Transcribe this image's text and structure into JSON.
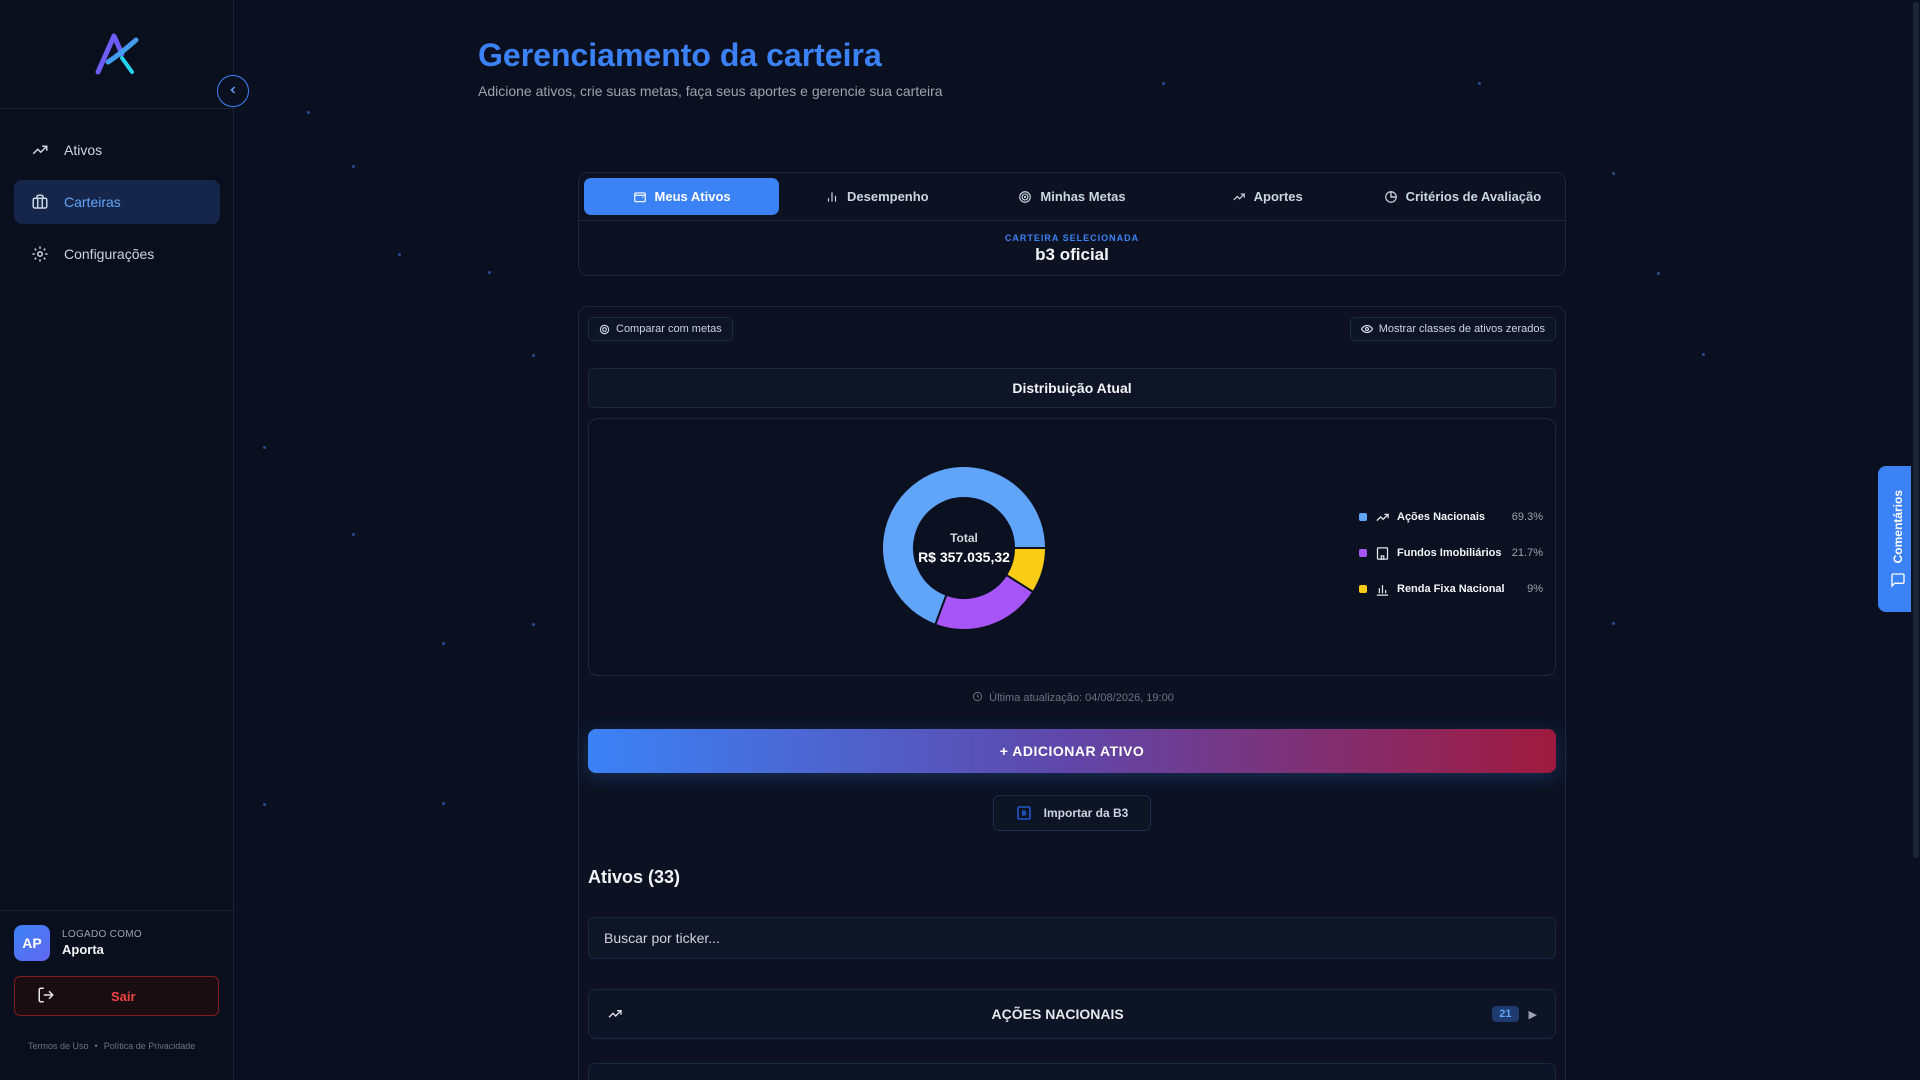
{
  "sidebar": {
    "nav": [
      {
        "label": "Ativos",
        "icon": "trending-up-icon"
      },
      {
        "label": "Carteiras",
        "icon": "briefcase-icon",
        "active": true
      },
      {
        "label": "Configurações",
        "icon": "gear-icon"
      }
    ],
    "user": {
      "initials": "AP",
      "caption": "LOGADO COMO",
      "name": "Aporta"
    },
    "logout_label": "Sair",
    "legal": {
      "terms": "Termos de Uso",
      "separator": "•",
      "privacy": "Política de Privacidade"
    }
  },
  "header": {
    "title": "Gerenciamento da carteira",
    "subtitle": "Adicione ativos, crie suas metas, faça seus aportes e gerencie sua carteira"
  },
  "tabs": [
    {
      "label": "Meus Ativos",
      "icon": "wallet-icon",
      "active": true
    },
    {
      "label": "Desempenho",
      "icon": "bar-chart-icon"
    },
    {
      "label": "Minhas Metas",
      "icon": "target-icon"
    },
    {
      "label": "Aportes",
      "icon": "trending-up-icon"
    },
    {
      "label": "Critérios de Avaliação",
      "icon": "pie-chart-icon"
    }
  ],
  "selected_wallet": {
    "caption": "CARTEIRA SELECIONADA",
    "name": "b3 oficial"
  },
  "controls": {
    "compare_label": "Comparar com metas",
    "show_zero_label": "Mostrar classes de ativos zerados"
  },
  "distribution": {
    "title": "Distribuição Atual",
    "total_label": "Total",
    "total_value": "R$ 357.035,32",
    "updated": "Última atualização: 04/08/2026, 19:00"
  },
  "chart_data": {
    "type": "pie",
    "donut": true,
    "categories": [
      "Ações Nacionais",
      "Fundos Imobiliários",
      "Renda Fixa Nacional"
    ],
    "values": [
      69.3,
      21.7,
      9
    ],
    "labels": [
      "69.3%",
      "21.7%",
      "9%"
    ],
    "colors": [
      "#60a5fa",
      "#a855f7",
      "#facc15"
    ],
    "icons": [
      "trending-up-icon",
      "building-icon",
      "bar-chart-icon"
    ],
    "legend_position": "right"
  },
  "actions": {
    "add_label": "+ ADICIONAR ATIVO",
    "import_label": "Importar da B3"
  },
  "assets": {
    "title": "Ativos (33)",
    "search_placeholder": "Buscar por ticker...",
    "groups": [
      {
        "name": "AÇÕES NACIONAIS",
        "count": "21",
        "icon": "trending-up-icon"
      }
    ]
  },
  "feedback_label": "Comentários",
  "colors": {
    "accent": "#3b82f6",
    "background": "#0b1020",
    "danger": "#ef4444"
  }
}
